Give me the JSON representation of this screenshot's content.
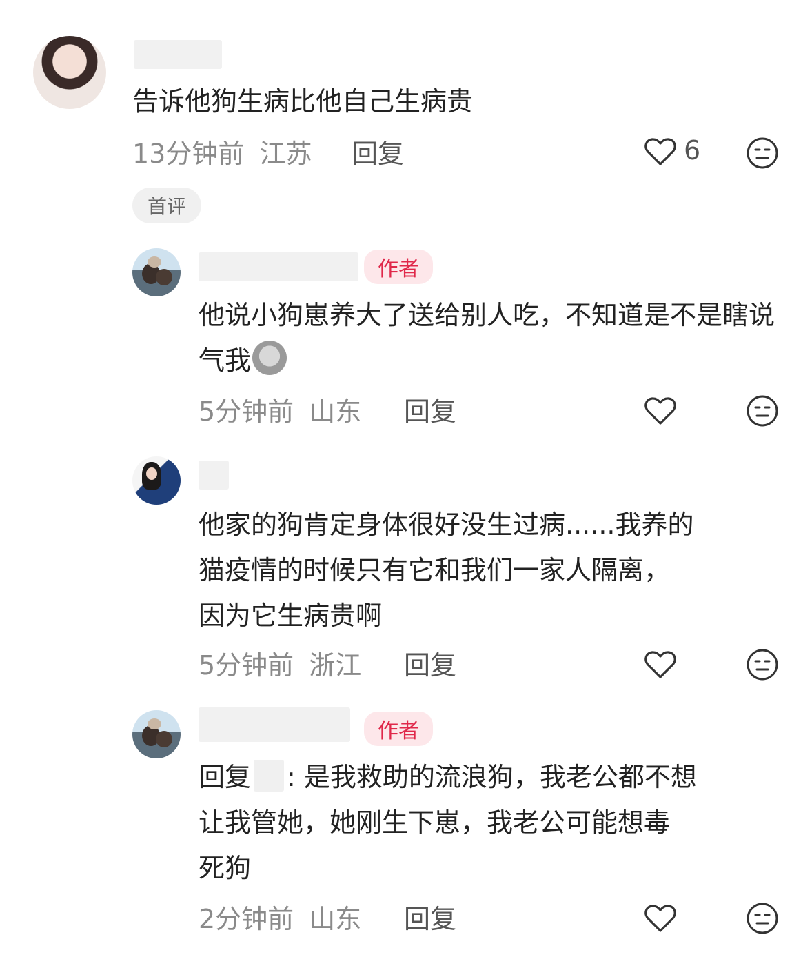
{
  "comments": [
    {
      "text": "告诉他狗生病比他自己生病贵",
      "time": "13分钟前",
      "location": "江苏",
      "reply_label": "回复",
      "likes": "6",
      "tag": "首评"
    },
    {
      "badge": "作者",
      "text": "他说小狗崽养大了送给别人吃，不知道是不是瞎说气我",
      "time": "5分钟前",
      "location": "山东",
      "reply_label": "回复"
    },
    {
      "text_line1": "他家的狗肯定身体很好没生过病......我养的",
      "text_line2": "猫疫情的时候只有它和我们一家人隔离，",
      "text_line3": "因为它生病贵啊",
      "time": "5分钟前",
      "location": "浙江",
      "reply_label": "回复"
    },
    {
      "badge": "作者",
      "reply_prefix": "回复",
      "text_part1": ": 是我救助的流浪狗，我老公都不想",
      "text_line2": "让我管她，她刚生下崽，我老公可能想毒",
      "text_line3": "死狗",
      "time": "2分钟前",
      "location": "山东",
      "reply_label": "回复"
    }
  ],
  "icons": {
    "like": "heart-outline-icon",
    "dislike": "neutral-face-icon",
    "emoji": "dumpling-emoji-icon"
  }
}
